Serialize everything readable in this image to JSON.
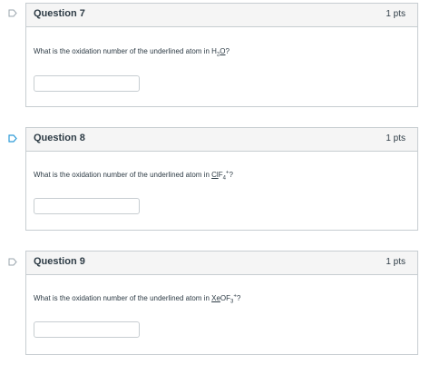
{
  "questions": [
    {
      "title": "Question 7",
      "points": "1 pts",
      "prompt_prefix": "What is the oxidation number of the underlined atom in ",
      "formula": {
        "p1": "H",
        "sub1": "2",
        "u": "O",
        "rest": "",
        "sub2": "",
        "sup": ""
      },
      "prompt_suffix": "?",
      "answer_value": ""
    },
    {
      "title": "Question 8",
      "points": "1 pts",
      "prompt_prefix": "What is the oxidation number of the underlined atom in ",
      "formula": {
        "p1": "",
        "sub1": "",
        "u": "Cl",
        "rest": "F",
        "sub2": "4",
        "sup": "+"
      },
      "prompt_suffix": "?",
      "answer_value": ""
    },
    {
      "title": "Question 9",
      "points": "1 pts",
      "prompt_prefix": "What is the oxidation number of the underlined atom in ",
      "formula": {
        "p1": "",
        "sub1": "",
        "u": "Xe",
        "rest": "OF",
        "sub2": "3",
        "sup": "+"
      },
      "prompt_suffix": "?",
      "answer_value": ""
    }
  ],
  "colors": {
    "flag_default": "#9aa5ad",
    "flag_active": "#2d9bd8",
    "border": "#c7cdd1",
    "header_bg": "#f5f5f5"
  }
}
